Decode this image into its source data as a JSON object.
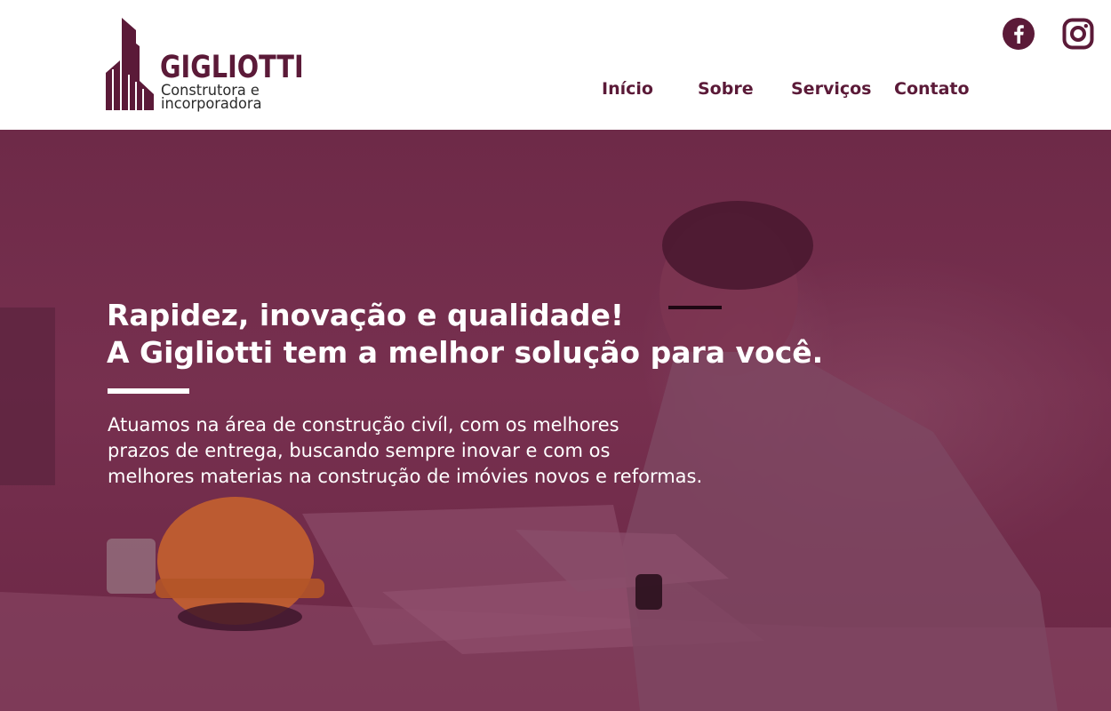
{
  "brand": {
    "name": "GIGLIOTTI",
    "subtitle_line1": "Construtora e",
    "subtitle_line2": "incorporadora",
    "primary_color": "#5b1a38"
  },
  "nav": {
    "items": [
      "Início",
      "Sobre",
      "Serviços",
      "Contato"
    ]
  },
  "social": {
    "icons": [
      "facebook-icon",
      "instagram-icon"
    ]
  },
  "hero": {
    "title_line1": "Rapidez, inovação e qualidade!",
    "title_line2": "A Gigliotti tem a melhor solução para você.",
    "text_line1": "Atuamos na área de construção civíl, com os melhores",
    "text_line2": "prazos de entrega, buscando sempre inovar e com os",
    "text_line3": "melhores materias na construção de imóvies novos e reformas.",
    "overlay_color": "#6e2a48"
  }
}
